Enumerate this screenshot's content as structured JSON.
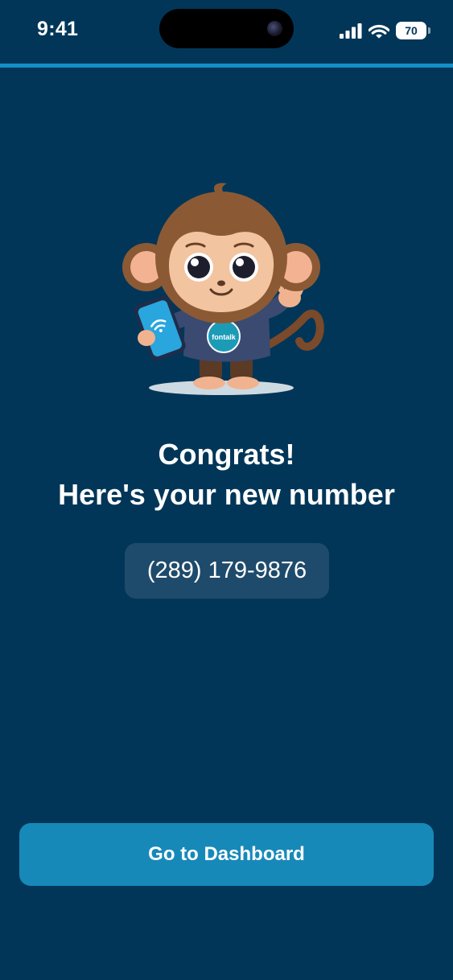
{
  "status_bar": {
    "time": "9:41",
    "battery": "70",
    "icons": [
      "cellular-signal-icon",
      "wifi-icon",
      "battery-icon"
    ]
  },
  "mascot": {
    "icon": "monkey-with-phone-illustration",
    "shirt_logo": "fontalk"
  },
  "title": {
    "line1": "Congrats!",
    "line2": "Here's your new number"
  },
  "phone_number": "(289) 179-9876",
  "button": {
    "label": "Go to Dashboard"
  },
  "colors": {
    "background": "#023658",
    "accent": "#1490c8",
    "button": "#1789b9",
    "number_pill": "#1e4b6c"
  }
}
